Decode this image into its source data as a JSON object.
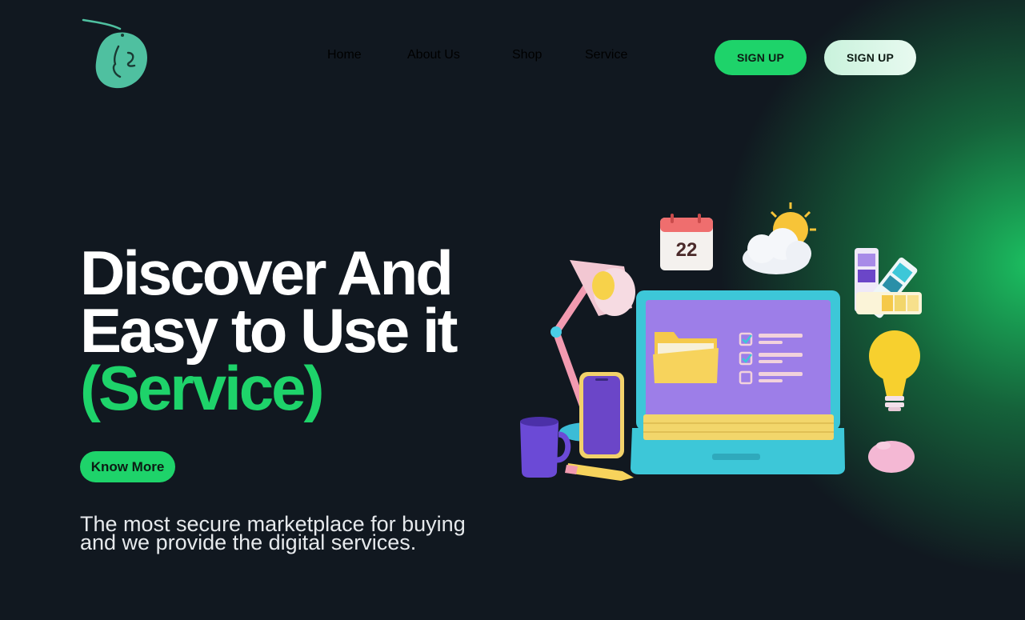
{
  "nav": {
    "items": [
      "Home",
      "About Us",
      "Shop",
      "Service"
    ]
  },
  "header": {
    "signup_primary": "SIGN UP",
    "signup_secondary": "SIGN UP"
  },
  "hero": {
    "title_line1": "Discover And",
    "title_line2": "Easy to Use it",
    "title_accent": "(Service)",
    "cta": "Know More",
    "description_line1": "The most secure marketplace for buying",
    "description_line2": "and we provide the digital services."
  },
  "illustration": {
    "calendar_day": "22"
  },
  "colors": {
    "background": "#111820",
    "accent": "#1ed36a",
    "accent_light": "#d8f6e6"
  },
  "icons": [
    "logo-head-icon",
    "calendar-icon",
    "sun-cloud-icon",
    "desk-lamp-icon",
    "laptop-icon",
    "folder-icon",
    "checklist-icon",
    "phone-icon",
    "mug-icon",
    "pencil-icon",
    "color-swatch-icon",
    "lightbulb-icon",
    "mouse-icon"
  ]
}
